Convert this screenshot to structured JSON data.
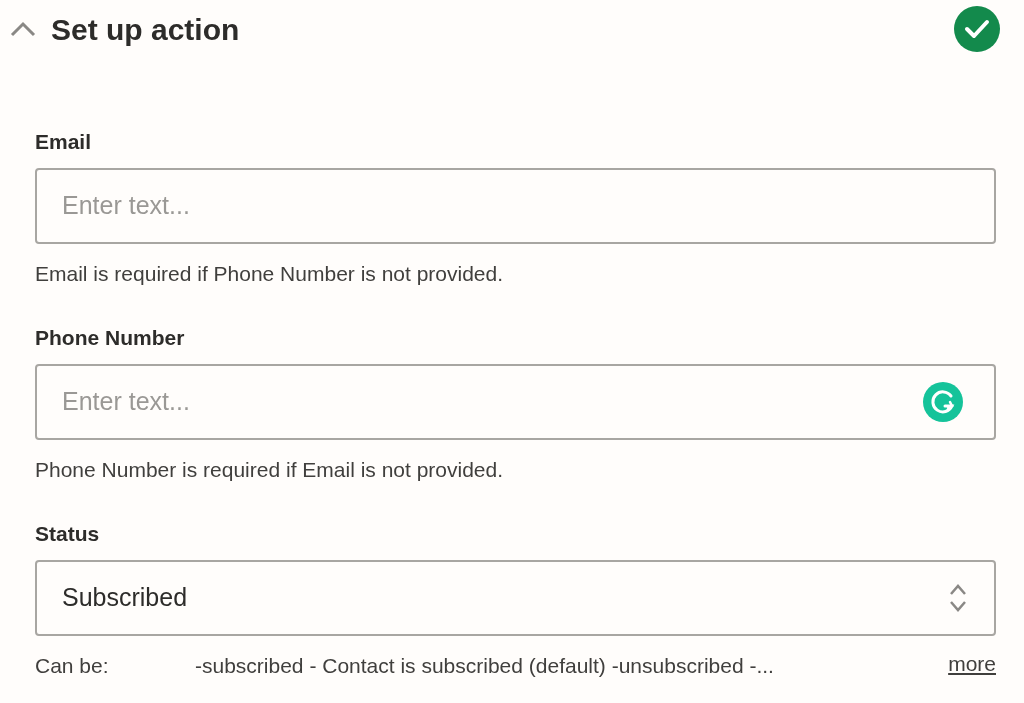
{
  "section": {
    "title": "Set up action",
    "expanded": true,
    "complete": true
  },
  "fields": [
    {
      "kind": "text",
      "label": "Email",
      "placeholder": "Enter text...",
      "help": "Email is required if Phone Number is not provided.",
      "grammarly": false
    },
    {
      "kind": "text",
      "label": "Phone Number",
      "placeholder": "Enter text...",
      "help": "Phone Number is required if Email is not provided.",
      "grammarly": true
    },
    {
      "kind": "select",
      "label": "Status",
      "value": "Subscribed",
      "help_label": "Can be:",
      "help": "-subscribed - Contact is subscribed (default) -unsubscribed -...",
      "more": "more"
    }
  ]
}
